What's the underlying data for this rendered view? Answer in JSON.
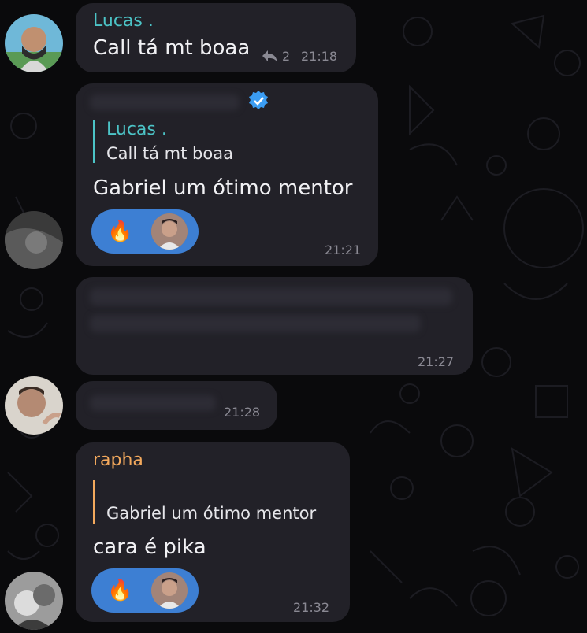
{
  "colors": {
    "bubble": "#222128",
    "lucas_name": "#4cc4c7",
    "rapha_name": "#f3a95d",
    "reaction_bg": "#3d7fd3",
    "verified": "#3b9df3",
    "timestamp": "#8a8993"
  },
  "messages": [
    {
      "sender": "Lucas .",
      "text": "Call tá mt boaa",
      "reply_count": "2",
      "reply_icon": "reply-arrow-icon",
      "time": "21:18"
    },
    {
      "sender_verified_icon": "verified-badge-icon",
      "reply_to": {
        "name": "Lucas .",
        "text": "Call tá mt boaa"
      },
      "text": "Gabriel um ótimo mentor",
      "reaction": {
        "emoji": "🔥"
      },
      "time": "21:21"
    },
    {
      "time": "21:27"
    },
    {
      "time": "21:28"
    },
    {
      "sender": "rapha",
      "reply_to": {
        "name": "",
        "text": "Gabriel um ótimo mentor"
      },
      "text": "cara é pika",
      "reaction": {
        "emoji": "🔥"
      },
      "time": "21:32"
    }
  ]
}
